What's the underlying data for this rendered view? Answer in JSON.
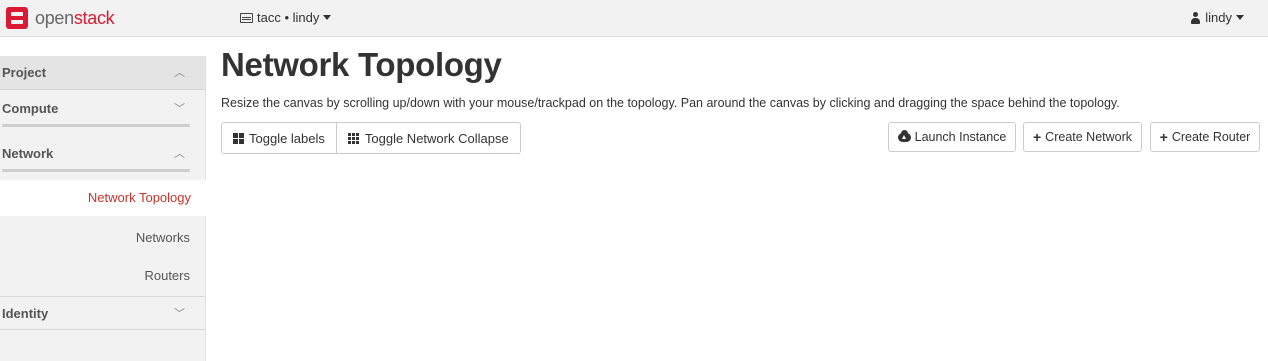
{
  "brand": {
    "part1": "open",
    "part2": "stack",
    "accent": "#da1a32"
  },
  "header": {
    "project_selector": "tacc • lindy",
    "user_menu": "lindy"
  },
  "sidebar": {
    "sections": [
      {
        "label": "Project",
        "state": "expanded"
      },
      {
        "label": "Compute",
        "state": "collapsed"
      },
      {
        "label": "Network",
        "state": "expanded"
      },
      {
        "label": "Identity",
        "state": "collapsed"
      }
    ],
    "network_items": [
      {
        "label": "Network Topology",
        "active": true
      },
      {
        "label": "Networks",
        "active": false
      },
      {
        "label": "Routers",
        "active": false
      }
    ],
    "active_color": "#c8332b"
  },
  "main": {
    "title": "Network Topology",
    "help_text": "Resize the canvas by scrolling up/down with your mouse/trackpad on the topology. Pan around the canvas by clicking and dragging the space behind the topology.",
    "toggle_buttons": {
      "labels": "Toggle labels",
      "collapse": "Toggle Network Collapse"
    },
    "actions": {
      "launch": "Launch Instance",
      "create_network": "Create Network",
      "create_router": "Create Router"
    }
  }
}
